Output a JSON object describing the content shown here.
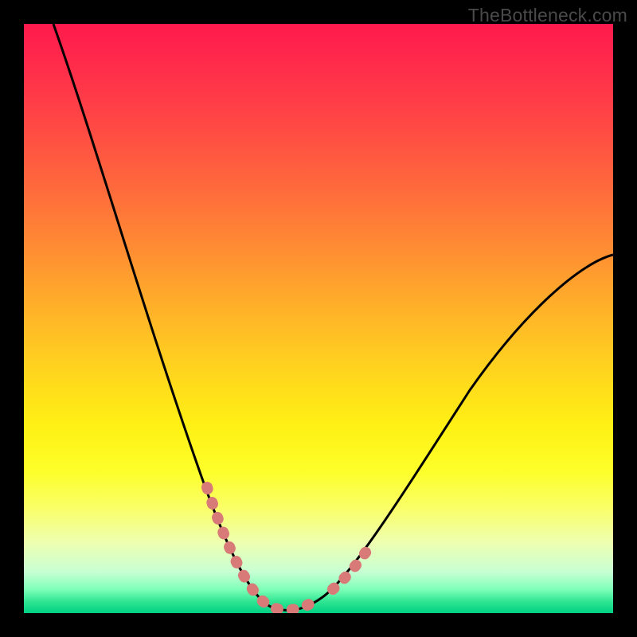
{
  "watermark": "TheBottleneck.com",
  "chart_data": {
    "type": "line",
    "title": "",
    "xlabel": "",
    "ylabel": "",
    "xlim": [
      0,
      100
    ],
    "ylim": [
      0,
      100
    ],
    "series": [
      {
        "name": "bottleneck-curve",
        "x": [
          5,
          10,
          15,
          20,
          25,
          30,
          34,
          37,
          40,
          43,
          47,
          52,
          58,
          65,
          73,
          82,
          91,
          100
        ],
        "y": [
          100,
          82,
          66,
          52,
          40,
          28,
          18,
          10,
          4,
          1,
          1,
          4,
          10,
          20,
          32,
          44,
          54,
          60
        ]
      }
    ],
    "highlight_segments": [
      {
        "name": "left-dip-marker",
        "x": [
          30,
          34,
          37,
          40
        ],
        "y": [
          28,
          18,
          10,
          4
        ]
      },
      {
        "name": "right-dip-marker",
        "x": [
          50,
          53,
          56
        ],
        "y": [
          3,
          5,
          8
        ]
      }
    ],
    "colors": {
      "curve": "#000000",
      "highlight": "#d87a78",
      "gradient_top": "#ff1a4d",
      "gradient_bottom": "#00d084"
    }
  }
}
